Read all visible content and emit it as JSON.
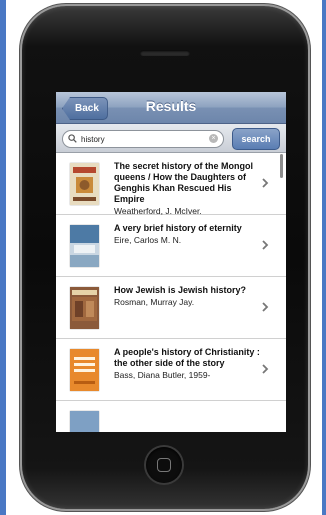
{
  "navbar": {
    "back_label": "Back",
    "title": "Results"
  },
  "search": {
    "value": "history",
    "button_label": "search"
  },
  "results": [
    {
      "title": "The secret history of the Mongol queens / How the Daughters of Genghis Khan Rescued His Empire",
      "author": "Weatherford, J. McIver."
    },
    {
      "title": "A very brief history of eternity",
      "author": "Eire, Carlos M. N."
    },
    {
      "title": "How Jewish is Jewish history?",
      "author": "Rosman, Murray Jay."
    },
    {
      "title": "A people's history of Christianity : the other side of the story",
      "author": "Bass, Diana Butler, 1959-"
    }
  ],
  "colors": {
    "background": "#4a78c4",
    "nav_bar": "#7990b3",
    "accent": "#5a7db3"
  }
}
